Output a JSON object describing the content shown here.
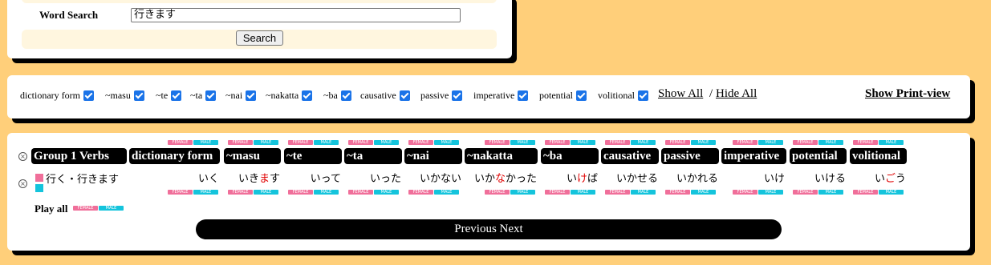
{
  "search": {
    "label": "Word Search",
    "value": "行きます",
    "button": "Search"
  },
  "filters": {
    "items": [
      "dictionary form",
      "~masu",
      "~te",
      "~ta",
      "~nai",
      "~nakatta",
      "~ba",
      "causative",
      "passive",
      "imperative",
      "potential",
      "volitional"
    ],
    "show_all": "Show All",
    "separator": "/",
    "hide_all": "Hide All",
    "print_view": "Show Print-view"
  },
  "table": {
    "group_label": "Group 1 Verbs",
    "headers": [
      "dictionary form",
      "~masu",
      "~te",
      "~ta",
      "~nai",
      "~nakatta",
      "~ba",
      "causative",
      "passive",
      "imperative",
      "potential",
      "volitional"
    ],
    "verb": "行く・行きます",
    "forms": [
      {
        "pre": "いく",
        "hl": "",
        "post": ""
      },
      {
        "pre": "いき",
        "hl": "ま",
        "post": "す"
      },
      {
        "pre": "いって",
        "hl": "",
        "post": ""
      },
      {
        "pre": "いった",
        "hl": "",
        "post": ""
      },
      {
        "pre": "いかない",
        "hl": "",
        "post": ""
      },
      {
        "pre": "いか",
        "hl": "な",
        "post": "かった"
      },
      {
        "pre": "い",
        "hl": "け",
        "post": "ば"
      },
      {
        "pre": "いかせる",
        "hl": "",
        "post": ""
      },
      {
        "pre": "いかれる",
        "hl": "",
        "post": ""
      },
      {
        "pre": "いけ",
        "hl": "",
        "post": ""
      },
      {
        "pre": "いける",
        "hl": "",
        "post": ""
      },
      {
        "pre": "い",
        "hl": "ご",
        "post": "う"
      }
    ],
    "play_all": "Play all",
    "female": "FEMALE",
    "male": "MALE",
    "nav": "Previous Next"
  },
  "colors": {
    "background": "#ffcf7a",
    "female": "#f06f9a",
    "male": "#14c4dc",
    "highlight": "#e00000",
    "checkbox": "#1a73e8"
  }
}
